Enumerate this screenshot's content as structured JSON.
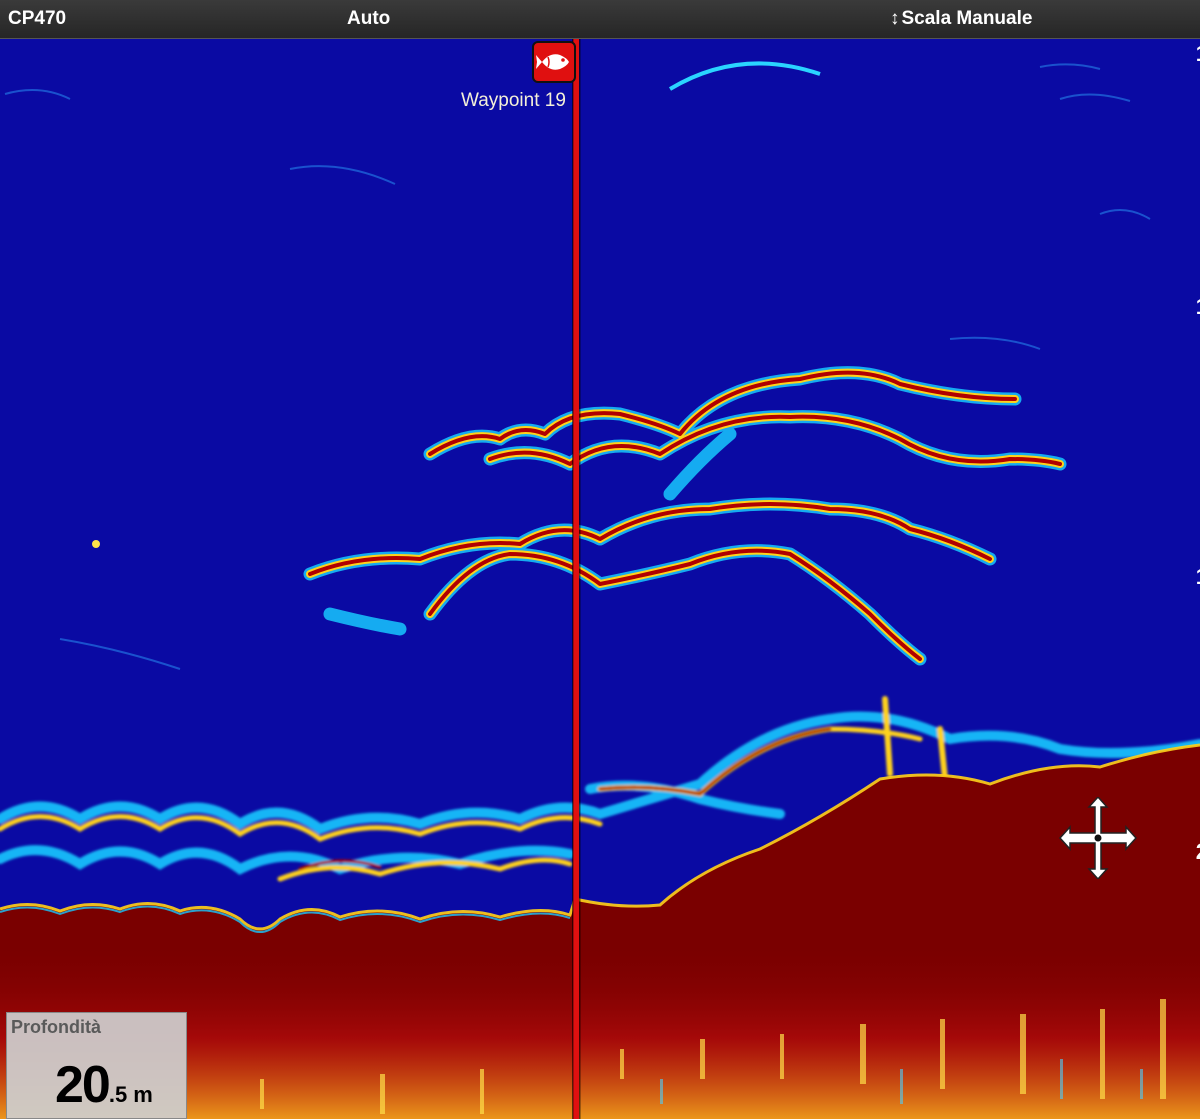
{
  "header": {
    "model": "CP470",
    "gain_mode": "Auto",
    "range_icon": "up-down-arrow-icon",
    "range_mode": "Scala Manuale"
  },
  "scale": {
    "labels": [
      "1",
      "1",
      "1",
      "2"
    ]
  },
  "waypoint": {
    "icon": "fish-waypoint-icon",
    "label": "Waypoint 19"
  },
  "cursor": {
    "icon": "move-cursor-icon"
  },
  "depth": {
    "title": "Profondità",
    "integer": "20",
    "decimal": ".5",
    "unit": "m"
  },
  "colors": {
    "water": "#0a0aa3",
    "bottom": "#7a0000",
    "echo_strong": "#b00000",
    "echo_mid": "#ffd21a",
    "echo_weak": "#18c8ff",
    "waypoint_line": "#e01010"
  }
}
